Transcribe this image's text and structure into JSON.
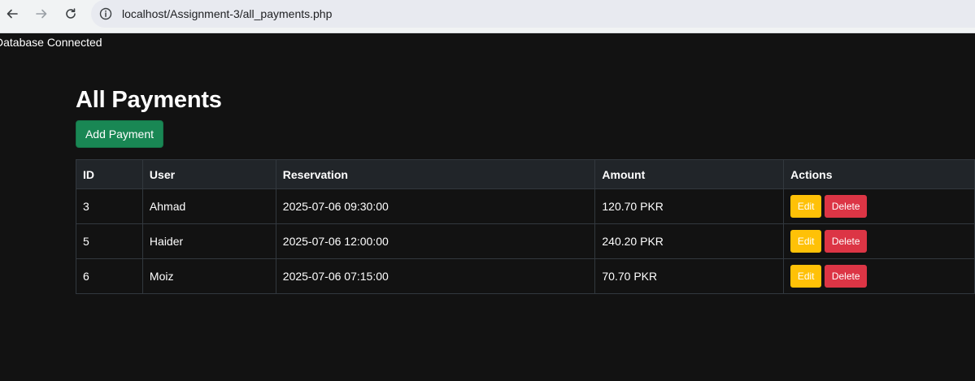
{
  "browser": {
    "url": "localhost/Assignment-3/all_payments.php"
  },
  "page": {
    "db_status": "Database Connected",
    "title": "All Payments",
    "add_button": "Add Payment"
  },
  "table": {
    "headers": [
      "ID",
      "User",
      "Reservation",
      "Amount",
      "Actions"
    ],
    "rows": [
      {
        "id": "3",
        "user": "Ahmad",
        "reservation": "2025-07-06 09:30:00",
        "amount": "120.70 PKR"
      },
      {
        "id": "5",
        "user": "Haider",
        "reservation": "2025-07-06 12:00:00",
        "amount": "240.20 PKR"
      },
      {
        "id": "6",
        "user": "Moiz",
        "reservation": "2025-07-06 07:15:00",
        "amount": "70.70 PKR"
      }
    ],
    "edit_label": "Edit",
    "delete_label": "Delete"
  },
  "colors": {
    "background": "#121212",
    "success": "#198754",
    "warning": "#ffc107",
    "danger": "#dc3545"
  }
}
